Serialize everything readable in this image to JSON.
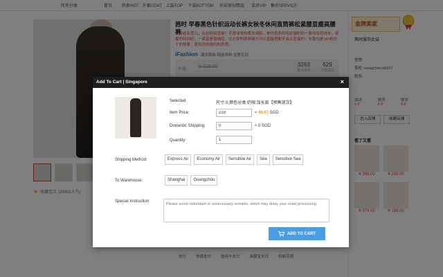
{
  "topnav": [
    "所有分类",
    "首页",
    "热卖HOT",
    "外套COAT",
    "上装TOP",
    "下装BOTTOM",
    "长安原创精选",
    "会员VIP",
    "售后SERVICE"
  ],
  "product": {
    "title": "茜时 早春黑色针织运动长裤女秋冬休闲直筒裤松紧腰显瘦高腰裤",
    "desc": "上身超有范儿，向且特别显瘦！手感非常的柔软细腻，是仿色系的毛织编织的一面均有色线长，穿着的特别好，一面直是很细挺，北方穿的穿很细方可以直接搭配不会太显瘦的！长款也是160的长个的效果，更有仿效简约的质感。",
    "brand": "iFashion",
    "brand_sub": "潮流服装 精选导购 优惠互动",
    "price_label": "价格",
    "old_price": "¥ 219.00",
    "stat1_value": "3263",
    "stat1_label": "累计评论",
    "stat2_value": "529",
    "stat2_label": "交易成功",
    "favorites": "收藏宝贝 (29483人气)"
  },
  "sidebar": {
    "badge": "金牌卖家",
    "shop_name": "茜时服饰女装",
    "credit": "信誉:",
    "seller": "掌柜: wangchenxi0927",
    "contact": "联系:",
    "metrics": [
      {
        "label": "描述",
        "value": "4.8"
      },
      {
        "label": "服务",
        "value": "4.8"
      },
      {
        "label": "物流",
        "value": "4.8"
      }
    ],
    "enter_shop": "进入店铺",
    "collect_shop": "收藏店铺",
    "also_title": "看了又看",
    "also_prices": [
      "¥ 399.00",
      "¥ 259.00",
      "¥ 379.00",
      "¥ 199.00"
    ]
  },
  "pay_row": [
    "支付",
    "快捷支付",
    "信用卡支付",
    "余额宝支付",
    "蚂蚁花呗"
  ],
  "modal": {
    "title": "Add To Cart | Singapore",
    "close": "×",
    "selected_label": "Selected",
    "selected_value": "尺寸:S;颜色分类:奶咖 加长款【预售现次】",
    "item_price_label": "Item Price:",
    "item_price_value": "219",
    "price_conv_prefix": "≈",
    "price_conv_amount": "48.67",
    "price_conv_currency": "SGD",
    "domestic_label": "Domestic Shipping:",
    "domestic_value": "0",
    "domestic_conv": "≈ 0 SGD",
    "qty_label": "Quantity:",
    "qty_value": "1",
    "shipping_label": "Shipping Method:",
    "shipping_options": [
      "Express Air",
      "Economy Air",
      "Sensitive Air",
      "Sea",
      "Sensitive Sea"
    ],
    "warehouse_label": "To Warehouse:",
    "warehouse_options": [
      "Shanghai",
      "Guangzhou"
    ],
    "instruction_label": "Special Instruction:",
    "instruction_placeholder": "Please avoid redundant or unnecessary remarks, which may delay your order processing.",
    "add_button": "ADD TO CART"
  },
  "colors": {
    "accent_orange": "#e8a317",
    "button_blue": "#4a9de2",
    "header_dark": "#1e1e1e",
    "price_red": "#e4393c"
  }
}
